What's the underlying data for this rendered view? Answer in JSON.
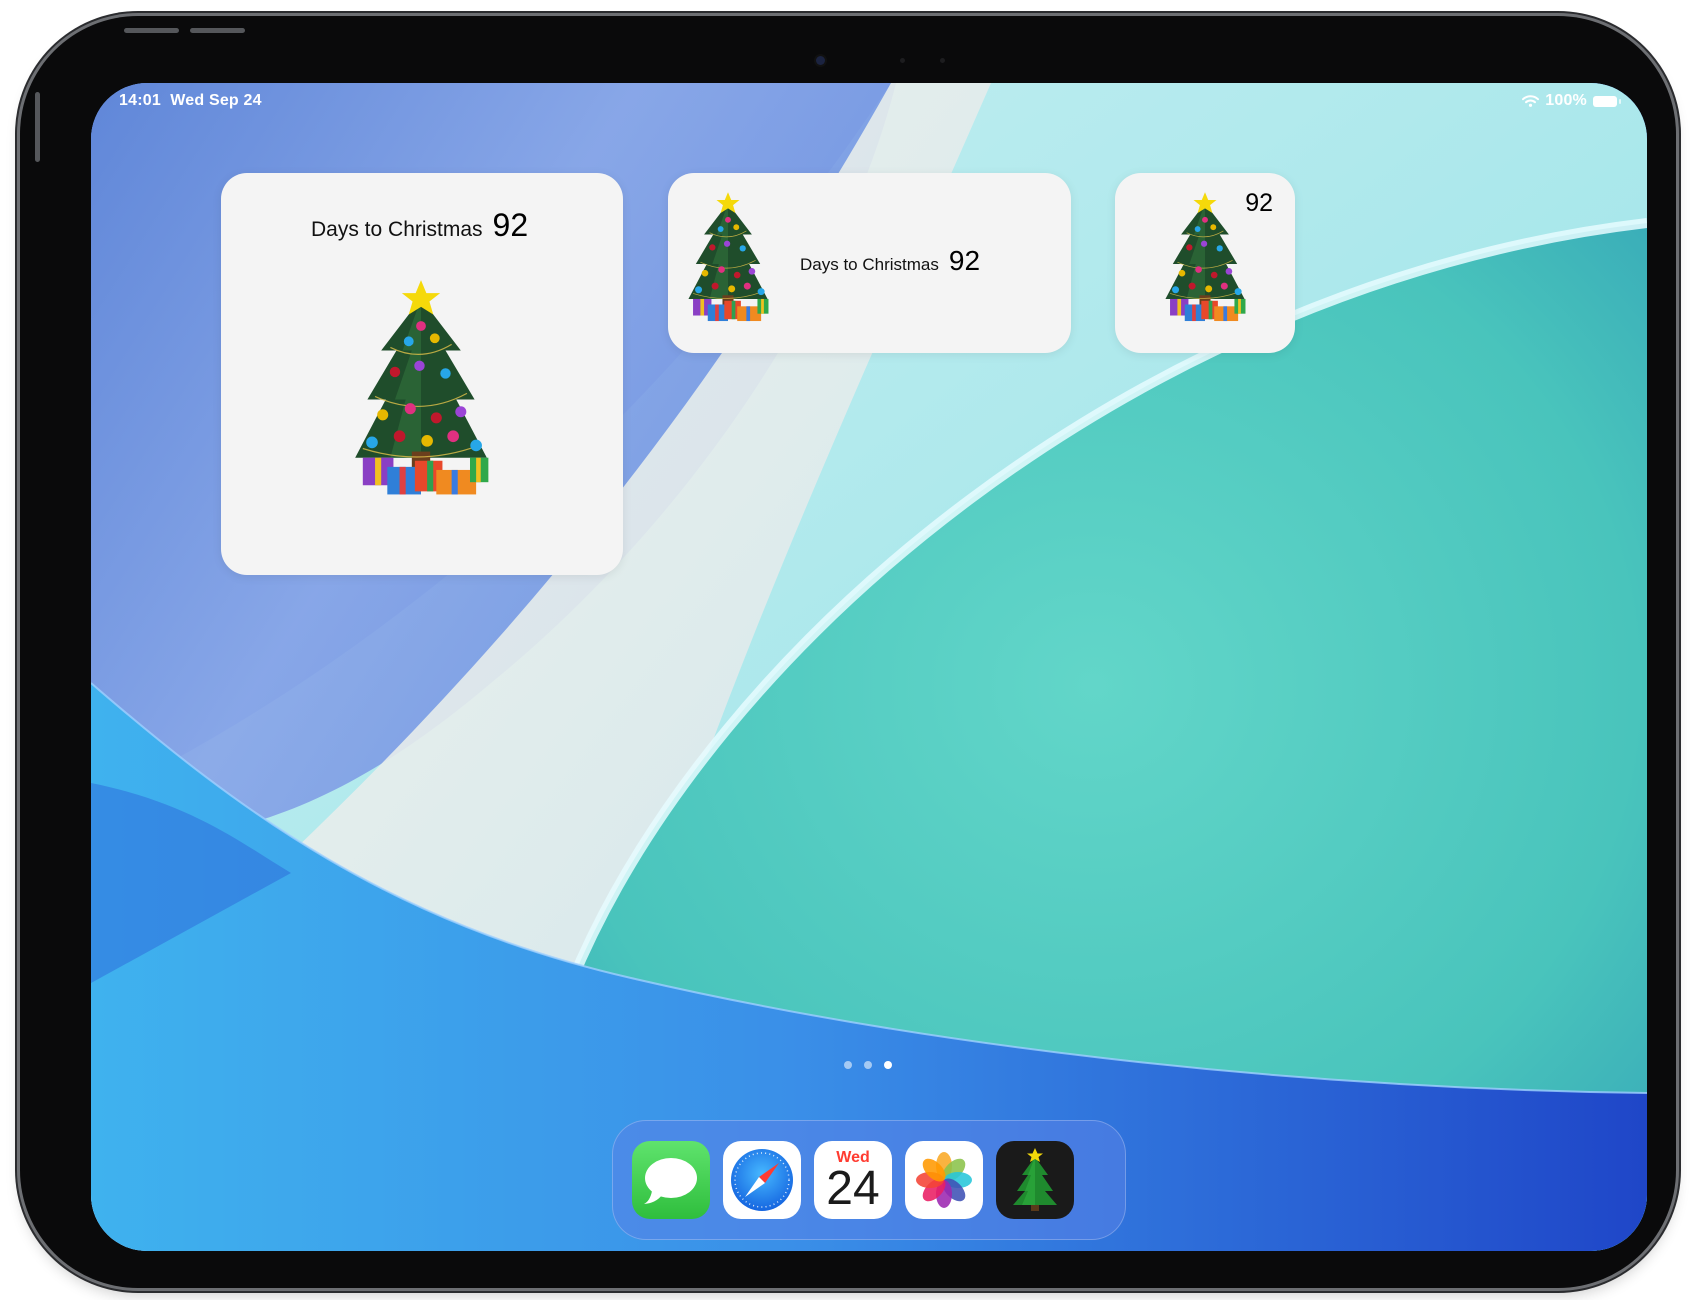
{
  "status_bar": {
    "time": "14:01",
    "date": "Wed Sep 24",
    "battery": "100%"
  },
  "widgets": {
    "large": {
      "title": "Days to Christmas",
      "days": "92"
    },
    "medium": {
      "title": "Days to Christmas",
      "days": "92"
    },
    "small": {
      "days": "92"
    }
  },
  "page_indicator": {
    "count": 3,
    "active": 3
  },
  "dock": {
    "apps": [
      "Messages",
      "Safari",
      "Calendar",
      "Photos",
      "Christmas Countdown"
    ],
    "calendar": {
      "weekday": "Wed",
      "day": "24"
    }
  },
  "colors": {
    "widget_bg": "#f4f4f4",
    "messages_green": "#34c759",
    "safari_blue": "#1e8cf0",
    "calendar_red": "#ff3b30"
  }
}
